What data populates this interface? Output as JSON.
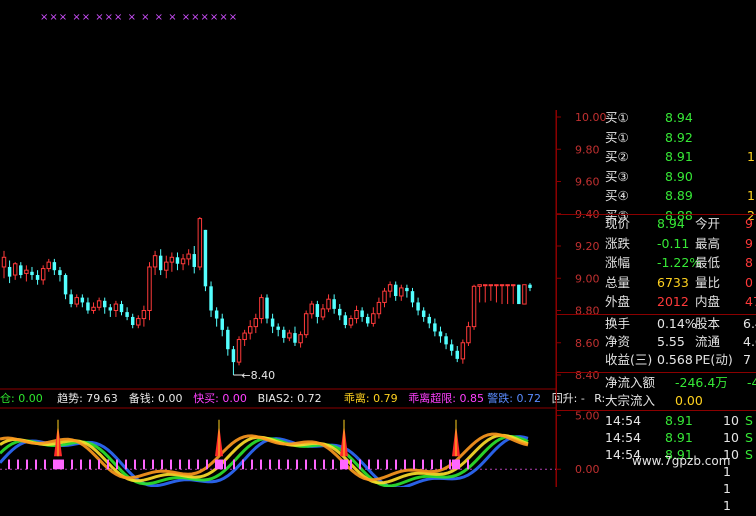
{
  "chart_data": {
    "type": "candlestick",
    "price_axis": {
      "ticks": [
        "10.00",
        "9.80",
        "9.60",
        "9.40",
        "9.20",
        "9.00",
        "8.80",
        "8.60",
        "8.40"
      ]
    },
    "min_marker_label": "8.40",
    "candles": [
      [
        9.07,
        9.13,
        9.0,
        9.17
      ],
      [
        9.07,
        9.01,
        8.97,
        9.11
      ],
      [
        9.02,
        9.09,
        8.99,
        9.1
      ],
      [
        9.08,
        9.02,
        9.0,
        9.1
      ],
      [
        9.03,
        9.05,
        8.98,
        9.08
      ],
      [
        9.04,
        9.02,
        8.99,
        9.07
      ],
      [
        9.02,
        8.99,
        8.96,
        9.05
      ],
      [
        8.99,
        9.06,
        8.96,
        9.08
      ],
      [
        9.06,
        9.1,
        9.04,
        9.12
      ],
      [
        9.1,
        9.05,
        9.02,
        9.12
      ],
      [
        9.05,
        9.02,
        8.98,
        9.07
      ],
      [
        9.02,
        8.9,
        8.87,
        9.03
      ],
      [
        8.9,
        8.84,
        8.82,
        8.93
      ],
      [
        8.84,
        8.88,
        8.82,
        8.9
      ],
      [
        8.88,
        8.85,
        8.82,
        8.9
      ],
      [
        8.85,
        8.8,
        8.78,
        8.88
      ],
      [
        8.8,
        8.82,
        8.78,
        8.85
      ],
      [
        8.82,
        8.86,
        8.8,
        8.88
      ],
      [
        8.86,
        8.82,
        8.78,
        8.88
      ],
      [
        8.82,
        8.8,
        8.76,
        8.84
      ],
      [
        8.8,
        8.84,
        8.76,
        8.86
      ],
      [
        8.84,
        8.79,
        8.77,
        8.86
      ],
      [
        8.79,
        8.76,
        8.74,
        8.82
      ],
      [
        8.76,
        8.71,
        8.69,
        8.78
      ],
      [
        8.71,
        8.75,
        8.69,
        8.77
      ],
      [
        8.75,
        8.8,
        8.7,
        8.83
      ],
      [
        8.8,
        9.07,
        8.74,
        9.1
      ],
      [
        9.07,
        9.14,
        9.02,
        9.17
      ],
      [
        9.14,
        9.05,
        9.02,
        9.18
      ],
      [
        9.05,
        9.1,
        9.0,
        9.14
      ],
      [
        9.1,
        9.13,
        9.04,
        9.16
      ],
      [
        9.13,
        9.09,
        9.05,
        9.16
      ],
      [
        9.09,
        9.12,
        9.05,
        9.15
      ],
      [
        9.12,
        9.15,
        9.08,
        9.18
      ],
      [
        9.15,
        9.07,
        9.03,
        9.2
      ],
      [
        9.07,
        9.37,
        9.05,
        9.38
      ],
      [
        9.3,
        8.95,
        8.92,
        9.3
      ],
      [
        8.95,
        8.8,
        8.76,
        8.98
      ],
      [
        8.8,
        8.75,
        8.7,
        8.82
      ],
      [
        8.75,
        8.68,
        8.64,
        8.78
      ],
      [
        8.68,
        8.56,
        8.52,
        8.7
      ],
      [
        8.56,
        8.48,
        8.4,
        8.58
      ],
      [
        8.48,
        8.62,
        8.46,
        8.64
      ],
      [
        8.62,
        8.66,
        8.58,
        8.68
      ],
      [
        8.66,
        8.7,
        8.62,
        8.74
      ],
      [
        8.7,
        8.75,
        8.66,
        8.78
      ],
      [
        8.75,
        8.88,
        8.72,
        8.9
      ],
      [
        8.88,
        8.75,
        8.72,
        8.9
      ],
      [
        8.75,
        8.7,
        8.66,
        8.78
      ],
      [
        8.7,
        8.68,
        8.64,
        8.72
      ],
      [
        8.68,
        8.63,
        8.6,
        8.7
      ],
      [
        8.63,
        8.66,
        8.61,
        8.68
      ],
      [
        8.66,
        8.6,
        8.58,
        8.7
      ],
      [
        8.6,
        8.65,
        8.57,
        8.67
      ],
      [
        8.65,
        8.78,
        8.63,
        8.8
      ],
      [
        8.78,
        8.84,
        8.75,
        8.86
      ],
      [
        8.84,
        8.76,
        8.72,
        8.86
      ],
      [
        8.76,
        8.81,
        8.74,
        8.84
      ],
      [
        8.81,
        8.87,
        8.79,
        8.9
      ],
      [
        8.87,
        8.81,
        8.78,
        8.9
      ],
      [
        8.81,
        8.77,
        8.74,
        8.84
      ],
      [
        8.77,
        8.71,
        8.69,
        8.79
      ],
      [
        8.71,
        8.75,
        8.69,
        8.77
      ],
      [
        8.75,
        8.8,
        8.72,
        8.83
      ],
      [
        8.8,
        8.76,
        8.73,
        8.82
      ],
      [
        8.76,
        8.72,
        8.7,
        8.78
      ],
      [
        8.72,
        8.78,
        8.7,
        8.82
      ],
      [
        8.78,
        8.85,
        8.75,
        8.88
      ],
      [
        8.85,
        8.92,
        8.82,
        8.94
      ],
      [
        8.92,
        8.96,
        8.88,
        8.98
      ],
      [
        8.96,
        8.89,
        8.86,
        8.98
      ],
      [
        8.89,
        8.94,
        8.86,
        8.96
      ],
      [
        8.94,
        8.92,
        8.88,
        8.96
      ],
      [
        8.92,
        8.85,
        8.82,
        8.94
      ],
      [
        8.85,
        8.8,
        8.77,
        8.88
      ],
      [
        8.8,
        8.76,
        8.73,
        8.82
      ],
      [
        8.76,
        8.72,
        8.69,
        8.78
      ],
      [
        8.72,
        8.67,
        8.64,
        8.75
      ],
      [
        8.67,
        8.64,
        8.6,
        8.7
      ],
      [
        8.64,
        8.59,
        8.56,
        8.66
      ],
      [
        8.59,
        8.55,
        8.52,
        8.62
      ],
      [
        8.55,
        8.5,
        8.48,
        8.58
      ],
      [
        8.5,
        8.6,
        8.47,
        8.62
      ],
      [
        8.6,
        8.7,
        8.58,
        8.73
      ],
      [
        8.7,
        8.95,
        8.68,
        8.96
      ],
      [
        8.95,
        8.96,
        8.85,
        8.96
      ],
      [
        8.96,
        8.96,
        8.85,
        8.96
      ],
      [
        8.96,
        8.96,
        8.86,
        8.96
      ],
      [
        8.96,
        8.96,
        8.85,
        8.96
      ],
      [
        8.96,
        8.96,
        8.84,
        8.96
      ],
      [
        8.96,
        8.96,
        8.84,
        8.96
      ],
      [
        8.96,
        8.96,
        8.84,
        8.96
      ],
      [
        8.96,
        8.84,
        8.84,
        8.96
      ],
      [
        8.84,
        8.96,
        8.84,
        8.96
      ],
      [
        8.96,
        8.94,
        8.92,
        8.97
      ]
    ],
    "indicator_axis": {
      "ticks": [
        "5.00",
        "0.00"
      ]
    },
    "indicator_bar": {
      "items": [
        {
          "label": "",
          "value": "0.00",
          "color": "#2ee62e",
          "tail": "趋仓"
        },
        {
          "label": "趋势:",
          "value": "79.63",
          "color": "#e8e8e8"
        },
        {
          "label": "备钱:",
          "value": "0.00",
          "color": "#e8e8e8"
        },
        {
          "label": "快买:",
          "value": "0.00",
          "color": "#ff40ff"
        },
        {
          "label": "BIAS2:",
          "value": "0.72",
          "color": "#e8e8e8"
        },
        {
          "label": "乖离:",
          "value": "0.79",
          "color": "#ffd21f"
        },
        {
          "label": "乖离超限:",
          "value": "0.85",
          "color": "#ff40ff"
        },
        {
          "label": "警跌:",
          "value": "0.72",
          "color": "#5a8cff"
        },
        {
          "label": "回升:",
          "value": "-",
          "color": "#e8e8e8"
        },
        {
          "label": "R:",
          "value": "",
          "color": "#e8e8e8"
        }
      ]
    },
    "top_markers": "××× ×× ××× × × × × ××××××"
  },
  "quote_panel": {
    "bids": [
      {
        "label": "买①",
        "price": "8.94"
      },
      {
        "label": "买①",
        "price": "8.92"
      },
      {
        "label": "买②",
        "price": "8.91"
      },
      {
        "label": "买③",
        "price": "8.90"
      },
      {
        "label": "买④",
        "price": "8.89"
      },
      {
        "label": "买⑤",
        "price": "8.88"
      }
    ],
    "bid_side_extra": [
      "",
      "",
      "1",
      "",
      "1",
      "2"
    ],
    "stats": [
      {
        "l1": "现价",
        "v1": "8.94",
        "c1": "dn",
        "l2": "今开",
        "v2": "9"
      },
      {
        "l1": "涨跌",
        "v1": "-0.11",
        "c1": "dn",
        "l2": "最高",
        "v2": "9"
      },
      {
        "l1": "涨幅",
        "v1": "-1.22%",
        "c1": "dn",
        "l2": "最低",
        "v2": "8"
      },
      {
        "l1": "总量",
        "v1": "6733",
        "c1": "yl",
        "l2": "量比",
        "v2": "0"
      },
      {
        "l1": "外盘",
        "v1": "2012",
        "c1": "up",
        "l2": "内盘",
        "v2": "47"
      }
    ],
    "fin": [
      {
        "l1": "换手",
        "v1": "0.14%",
        "l2": "股本",
        "v2": "6.49"
      },
      {
        "l1": "净资",
        "v1": "5.55",
        "l2": "流通",
        "v2": "4.69"
      },
      {
        "l1": "收益(三)",
        "v1": "0.568",
        "l2": "PE(动)",
        "v2": "7"
      }
    ],
    "flow": [
      {
        "label": "净流入额",
        "value": "-246.4万",
        "extra": "-4"
      },
      {
        "label": "大宗流入",
        "value": "0.00",
        "extra": ""
      }
    ],
    "ticks": [
      {
        "time": "14:54",
        "price": "8.91",
        "vol": "10",
        "side": "S"
      },
      {
        "time": "14:54",
        "price": "8.91",
        "vol": "10",
        "side": "S"
      },
      {
        "time": "14:54",
        "price": "8.91",
        "vol": "10",
        "side": "S"
      },
      {
        "time": "",
        "price": "",
        "vol": "1",
        "side": ""
      },
      {
        "time": "",
        "price": "",
        "vol": "1",
        "side": ""
      },
      {
        "time": "",
        "price": "",
        "vol": "1",
        "side": ""
      }
    ],
    "watermark": "www.7gpzb.com"
  },
  "colors": {
    "up": "#ff3a3a",
    "down": "#36e836",
    "cyan": "#54ffff",
    "axis": "#8b0000"
  }
}
